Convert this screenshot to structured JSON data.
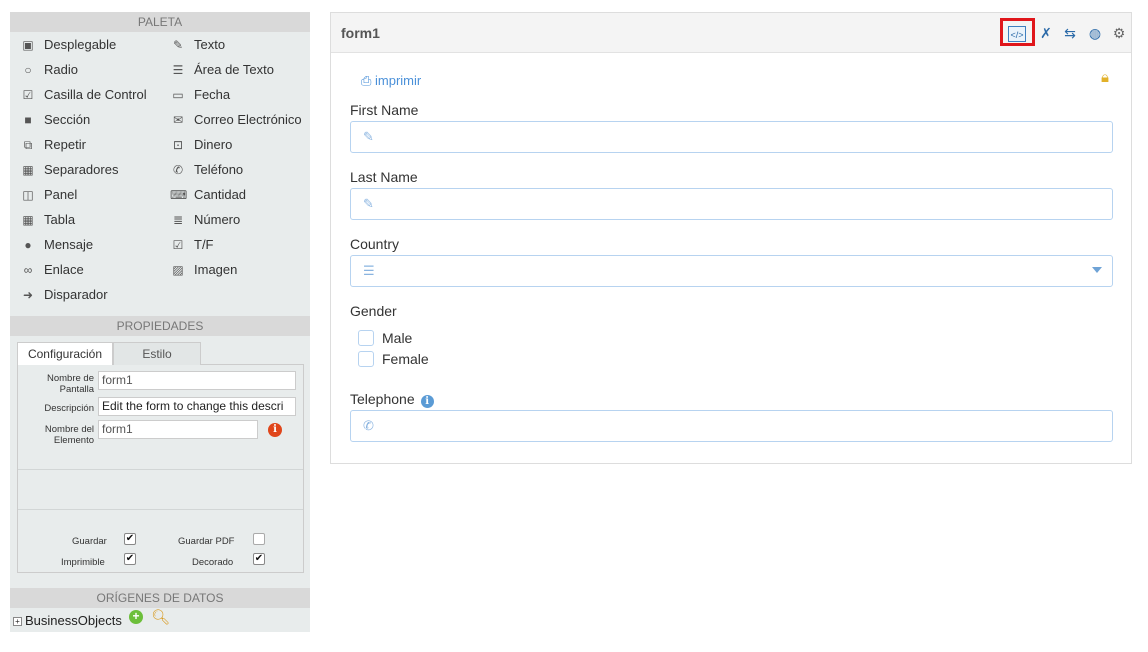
{
  "palette": {
    "title": "PALETA",
    "items_left": [
      {
        "label": "Desplegable",
        "icon": "dropdown-icon"
      },
      {
        "label": "Radio",
        "icon": "radio-icon"
      },
      {
        "label": "Casilla de Control",
        "icon": "checkbox-icon"
      },
      {
        "label": "Sección",
        "icon": "folder-icon"
      },
      {
        "label": "Repetir",
        "icon": "repeat-icon"
      },
      {
        "label": "Separadores",
        "icon": "grid-icon"
      },
      {
        "label": "Panel",
        "icon": "panel-icon"
      },
      {
        "label": "Tabla",
        "icon": "table-icon"
      },
      {
        "label": "Mensaje",
        "icon": "message-icon"
      },
      {
        "label": "Enlace",
        "icon": "link-icon"
      },
      {
        "label": "Disparador",
        "icon": "trigger-icon"
      }
    ],
    "items_right": [
      {
        "label": "Texto",
        "icon": "edit-icon"
      },
      {
        "label": "Área de Texto",
        "icon": "textarea-icon"
      },
      {
        "label": "Fecha",
        "icon": "calendar-icon"
      },
      {
        "label": "Correo Electrónico",
        "icon": "envelope-icon"
      },
      {
        "label": "Dinero",
        "icon": "money-icon"
      },
      {
        "label": "Teléfono",
        "icon": "phone-icon"
      },
      {
        "label": "Cantidad",
        "icon": "keyboard-icon"
      },
      {
        "label": "Número",
        "icon": "numbered-list-icon"
      },
      {
        "label": "T/F",
        "icon": "check-icon"
      },
      {
        "label": "Imagen",
        "icon": "image-icon"
      }
    ]
  },
  "properties": {
    "title": "PROPIEDADES",
    "tabs": [
      "Configuración",
      "Estilo"
    ],
    "screen_name_label": "Nombre de Pantalla",
    "screen_name_value": "form1",
    "description_label": "Descripción",
    "description_value": "Edit the form to change this descri",
    "element_name_label": "Nombre del Elemento",
    "element_name_value": "form1",
    "checkboxes": {
      "guardar": {
        "label": "Guardar",
        "checked": true
      },
      "guardar_pdf": {
        "label": "Guardar PDF",
        "checked": false
      },
      "imprimible": {
        "label": "Imprimible",
        "checked": true
      },
      "decorado": {
        "label": "Decorado",
        "checked": true
      }
    },
    "check_mark": "✔"
  },
  "datasources": {
    "title": "ORÍGENES DE DATOS",
    "item": "BusinessObjects"
  },
  "form": {
    "title": "form1",
    "print_label": "imprimir",
    "fields": {
      "first_name": "First Name",
      "last_name": "Last Name",
      "country": "Country",
      "gender": "Gender",
      "telephone": "Telephone"
    },
    "gender_options": [
      "Male",
      "Female"
    ]
  },
  "colors": {
    "highlight": "#e0161b",
    "accent": "#4a90d9",
    "input_border": "#b7d3f0"
  }
}
